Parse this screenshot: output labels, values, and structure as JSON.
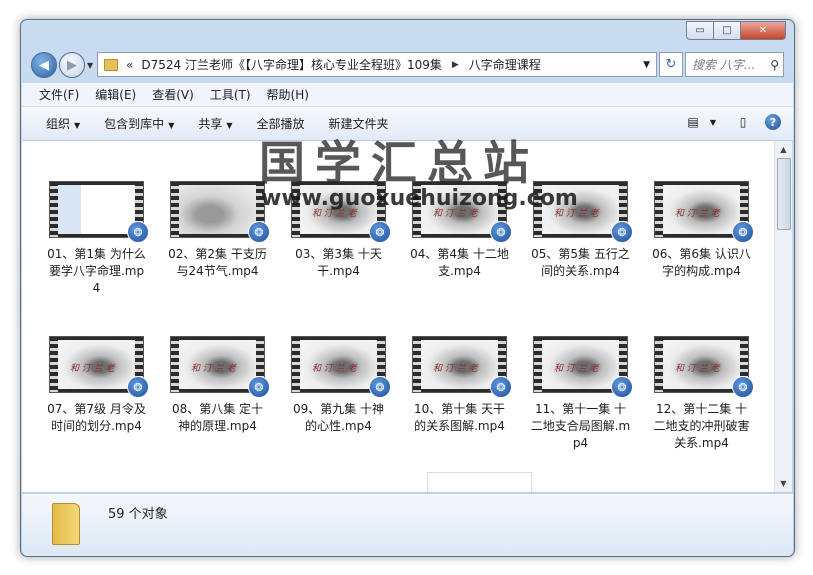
{
  "window": {
    "controls": {
      "minimize": "▭",
      "maximize": "□",
      "close": "✕"
    }
  },
  "nav": {
    "back": "◀",
    "forward": "▶",
    "address_chevron": "«",
    "address_path": "D7524 汀兰老师《【八字命理】核心专业全程班》109集",
    "address_sep": "▶",
    "address_current": "八字命理课程",
    "address_dropdown": "▼",
    "refresh": "↻",
    "search_placeholder": "搜索 八字...",
    "search_icon": "⚲"
  },
  "menu": [
    "文件(F)",
    "编辑(E)",
    "查看(V)",
    "工具(T)",
    "帮助(H)"
  ],
  "toolbar": {
    "organize": "组织",
    "include_library": "包含到库中",
    "share": "共享",
    "play_all": "全部播放",
    "new_folder": "新建文件夹",
    "dropdown_arrow": "▼",
    "view_icon": "▤",
    "pane_icon": "▯",
    "help_icon": "?"
  },
  "files": [
    {
      "name": "01、第1集 为什么要学八字命理.mp4",
      "thumb": "first"
    },
    {
      "name": "02、第2集 干支历与24节气.mp4",
      "thumb": "second"
    },
    {
      "name": "03、第3集 十天干.mp4",
      "thumb": "ink"
    },
    {
      "name": "04、第4集 十二地支.mp4",
      "thumb": "ink"
    },
    {
      "name": "05、第5集 五行之间的关系.mp4",
      "thumb": "ink"
    },
    {
      "name": "06、第6集 认识八字的构成.mp4",
      "thumb": "ink"
    },
    {
      "name": "07、第7级 月令及时间的划分.mp4",
      "thumb": "ink"
    },
    {
      "name": "08、第八集 定十神的原理.mp4",
      "thumb": "ink"
    },
    {
      "name": "09、第九集 十神的心性.mp4",
      "thumb": "ink"
    },
    {
      "name": "10、第十集 天干的关系图解.mp4",
      "thumb": "ink"
    },
    {
      "name": "11、第十一集 十二地支合局图解.mp4",
      "thumb": "ink"
    },
    {
      "name": "12、第十二集 十二地支的冲刑破害关系.mp4",
      "thumb": "ink"
    }
  ],
  "thumb_caption": "和 汀 兰 老",
  "badge_icon": "❂",
  "watermark": {
    "text": "国学汇总站",
    "url": "www.guoxuehuizong.com"
  },
  "scrollbar": {
    "up": "▲",
    "down": "▼"
  },
  "status": {
    "count": "59 个对象"
  },
  "cursor": "⇕"
}
